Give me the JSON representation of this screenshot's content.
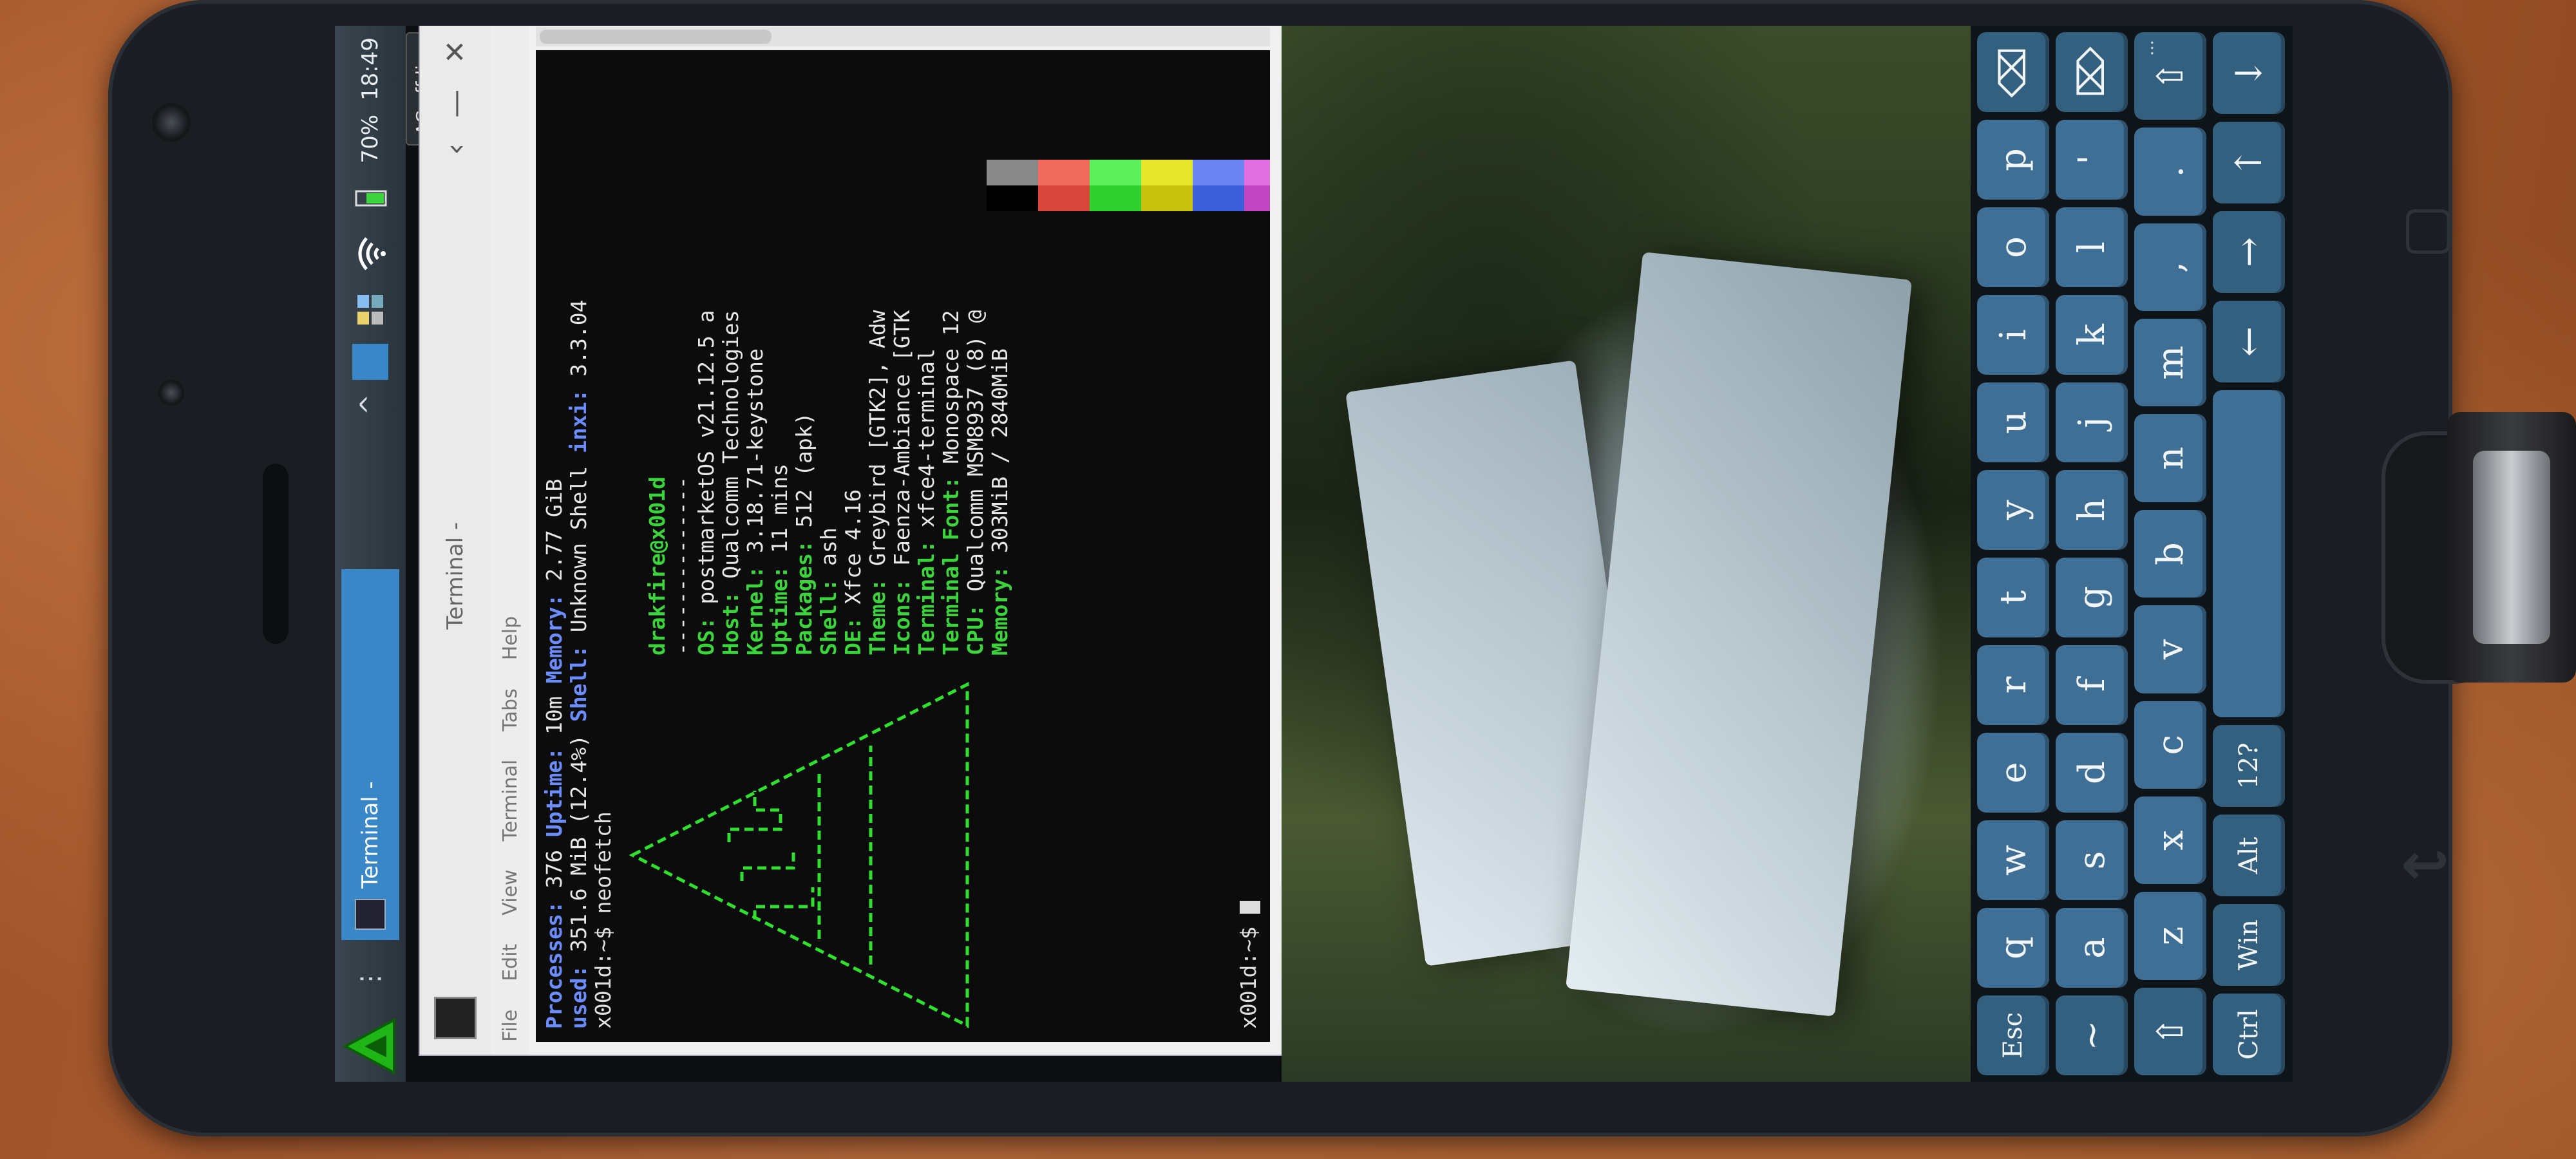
{
  "panel": {
    "task_title": "Terminal -",
    "battery": "70%",
    "clock": "18:49",
    "ac_status": "AC off-line"
  },
  "window": {
    "title": "Terminal -",
    "menu": [
      "File",
      "Edit",
      "View",
      "Terminal",
      "Tabs",
      "Help"
    ]
  },
  "terminal": {
    "line1_labels": [
      "Processes:",
      " 376 ",
      "Uptime:",
      " 10m ",
      "Memory:",
      " 2.77 GiB"
    ],
    "line2_labels": [
      "used: ",
      "351.6 MiB (12.4%) ",
      "Shell:",
      " Unknown Shell ",
      "inxi:",
      " 3.3.04"
    ],
    "prompt1": "x001d:~$ ",
    "cmd1": "neofetch",
    "user_host": "drakfire@x001d",
    "separator": "--------------",
    "info": [
      {
        "key": "OS:",
        "val": " postmarketOS v21.12.5 a"
      },
      {
        "key": "Host:",
        "val": " Qualcomm Technologies"
      },
      {
        "key": "Kernel:",
        "val": " 3.18.71-keystone"
      },
      {
        "key": "Uptime:",
        "val": " 11 mins"
      },
      {
        "key": "Packages:",
        "val": " 512 (apk)"
      },
      {
        "key": "Shell:",
        "val": " ash"
      },
      {
        "key": "DE:",
        "val": " Xfce 4.16"
      },
      {
        "key": "Theme:",
        "val": " Greybird [GTK2], Adw"
      },
      {
        "key": "Icons:",
        "val": " Faenza-Ambiance [GTK"
      },
      {
        "key": "Terminal:",
        "val": " xfce4-terminal"
      },
      {
        "key": "Terminal Font:",
        "val": " Monospace 12"
      },
      {
        "key": "CPU:",
        "val": " Qualcomm MSM8937 (8) @"
      },
      {
        "key": "Memory:",
        "val": " 303MiB / 2840MiB"
      }
    ],
    "prompt2": "x001d:~$ ",
    "palette": [
      "#000000",
      "#d9463b",
      "#2fd02f",
      "#c8c20c",
      "#3c5ed8",
      "#c246c2",
      "#11c6d0",
      "#c8c8c8"
    ],
    "palette_bright": [
      "#8a8a8a",
      "#f06a5e",
      "#5cf05c",
      "#e6e62a",
      "#6c84f4",
      "#e070e0",
      "#42e6ee",
      "#ffffff"
    ]
  },
  "keyboard": {
    "row1": [
      "q",
      "w",
      "e",
      "r",
      "t",
      "y",
      "u",
      "i",
      "o",
      "p"
    ],
    "row1_left": "Esc",
    "row1_right": "⌫",
    "row2": [
      "a",
      "s",
      "d",
      "f",
      "g",
      "h",
      "j",
      "k",
      "l",
      "'"
    ],
    "row2_left": "~",
    "row2_right": "⌦",
    "row3": [
      "z",
      "x",
      "c",
      "v",
      "b",
      "n",
      "m",
      ",",
      "."
    ],
    "row3_left": "⇧",
    "row3_right": "⇧",
    "row3_extra": "...",
    "row4": [
      "Ctrl",
      "Win",
      "Alt",
      "12?",
      "",
      "←",
      "→",
      "↑",
      "↓"
    ]
  }
}
